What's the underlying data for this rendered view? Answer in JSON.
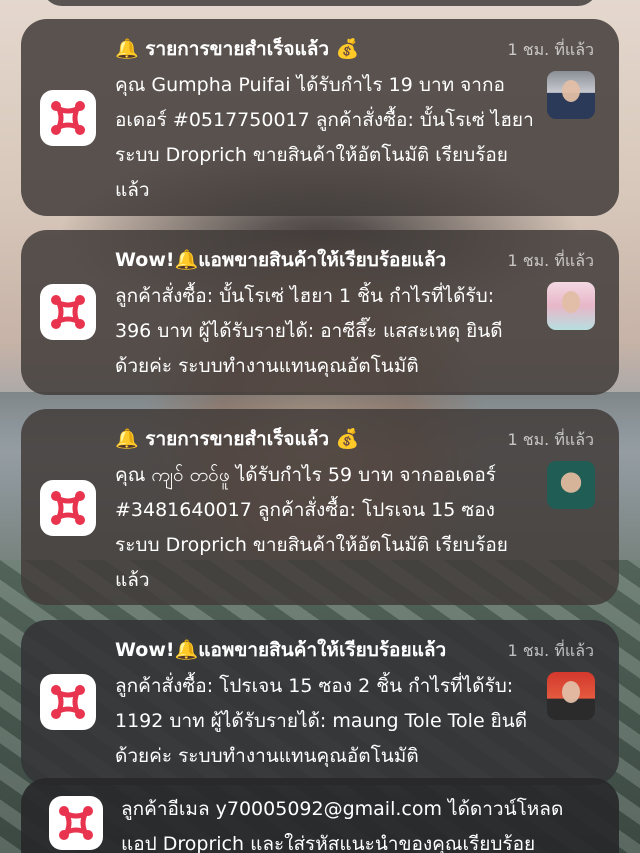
{
  "background": "lock screen photo",
  "brand_color": "#e8344e",
  "notifications": [
    {
      "title": "🔔 รายการขายสำเร็จแล้ว 💰",
      "time": "1 ชม. ที่แล้ว",
      "body": "คุณ Gumpha Puifai ได้รับกำไร 19 บาท จากออเดอร์ #0517750017 ลูกค้าสั่งซื้อ: บั้นโรเซ่ ไฮยา ระบบ Droprich ขายสินค้าให้อัตโนมัติ เรียบร้อยแล้ว",
      "avatar": "man-suit-avatar"
    },
    {
      "title": "Wow!🔔แอพขายสินค้าให้เรียบร้อยแล้ว",
      "time": "1 ชม. ที่แล้ว",
      "body": "ลูกค้าสั่งซื้อ: บั้นโรเซ่ ไฮยา 1 ชิ้น กำไรที่ได้รับ: 396 บาท ผู้ได้รับรายได้: อาซีสึ๊ะ แสสะเหตุ ยินดีด้วยค่ะ ระบบทำงานแทนคุณอัตโนมัติ",
      "avatar": "woman-hijab-avatar"
    },
    {
      "title": "🔔 รายการขายสำเร็จแล้ว 💰",
      "time": "1 ชม. ที่แล้ว",
      "body": "คุณ ကျဝ် တဝ်ဖူ ได้รับกำไร 59 บาท จากออเดอร์ #3481640017 ลูกค้าสั่งซื้อ: โปรเจน 15 ซอง ระบบ Droprich ขายสินค้าให้อัตโนมัติ เรียบร้อยแล้ว",
      "avatar": "man-green-avatar"
    },
    {
      "title": "Wow!🔔แอพขายสินค้าให้เรียบร้อยแล้ว",
      "time": "1 ชม. ที่แล้ว",
      "body": "ลูกค้าสั่งซื้อ: โปรเจน 15 ซอง 2 ชิ้น กำไรที่ได้รับ: 1192 บาท ผู้ได้รับรายได้: maung Tole Tole ยินดีด้วยค่ะ ระบบทำงานแทนคุณอัตโนมัติ",
      "avatar": "man-red-avatar"
    },
    {
      "title": "",
      "time": "",
      "body": "ลูกค้าอีเมล y70005092@gmail.com ได้ดาวน์โหลดแอป Droprich และใส่รหัสแนะนำของคุณเรียบร้อย"
    }
  ]
}
